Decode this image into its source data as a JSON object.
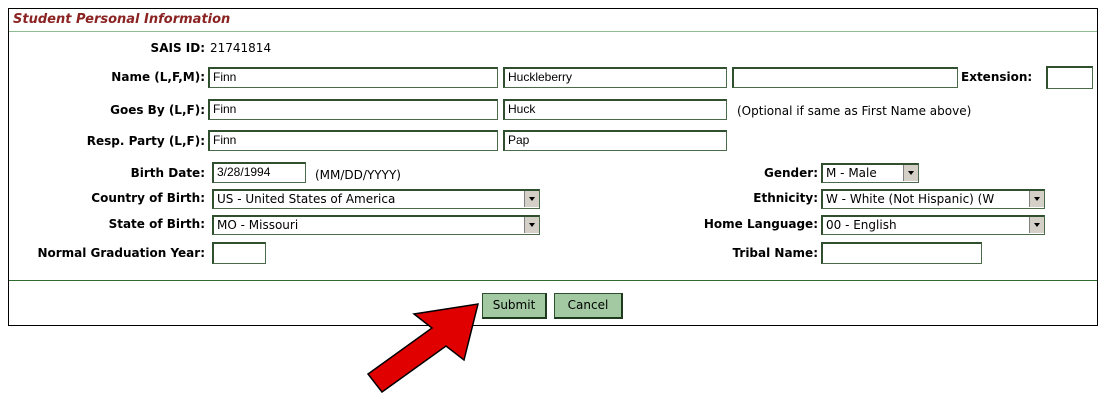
{
  "section": {
    "title": "Student Personal Information"
  },
  "sais": {
    "label": "SAIS ID:",
    "value": "21741814"
  },
  "name": {
    "label": "Name (L,F,M):",
    "last": "Finn",
    "first": "Huckleberry",
    "middle": ""
  },
  "extension": {
    "label": "Extension:",
    "value": ""
  },
  "goes_by": {
    "label": "Goes By (L,F):",
    "last": "Finn",
    "first": "Huck",
    "note": "(Optional if same as First Name above)"
  },
  "resp_party": {
    "label": "Resp. Party (L,F):",
    "last": "Finn",
    "first": "Pap"
  },
  "birth_date": {
    "label": "Birth Date:",
    "value": "3/28/1994",
    "hint": "(MM/DD/YYYY)"
  },
  "gender": {
    "label": "Gender:",
    "value": "M - Male"
  },
  "country_of_birth": {
    "label": "Country of Birth:",
    "value": "US - United States of America"
  },
  "ethnicity": {
    "label": "Ethnicity:",
    "value": "W - White (Not Hispanic) (W"
  },
  "state_of_birth": {
    "label": "State of Birth:",
    "value": "MO - Missouri"
  },
  "home_language": {
    "label": "Home Language:",
    "value": "00 - English"
  },
  "graduation_year": {
    "label": "Normal Graduation Year:",
    "value": ""
  },
  "tribal_name": {
    "label": "Tribal Name:",
    "value": ""
  },
  "buttons": {
    "submit": "Submit",
    "cancel": "Cancel"
  },
  "colors": {
    "title": "#8b2323",
    "button_bg": "#a3c9a3",
    "rule": "#2e6b2e",
    "arrow": "#e00000"
  }
}
